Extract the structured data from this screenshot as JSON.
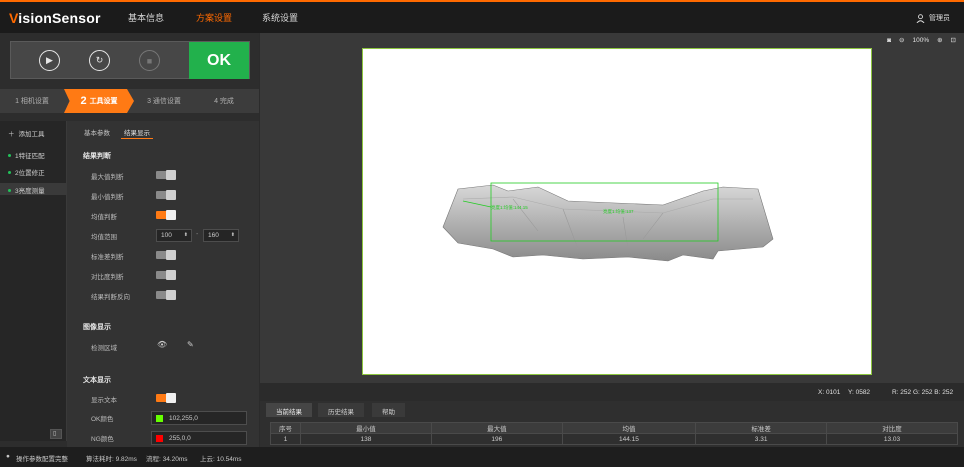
{
  "app": {
    "logo_prefix": "V",
    "logo_rest": "isionSensor"
  },
  "nav": {
    "items": [
      "基本信息",
      "方案设置",
      "系统设置"
    ],
    "active": 1
  },
  "user": {
    "name": "管理员"
  },
  "run": {
    "ok_label": "OK"
  },
  "steps": [
    {
      "num": "1",
      "label": "相机设置"
    },
    {
      "num": "2",
      "label": "工具设置"
    },
    {
      "num": "3",
      "label": "通信设置"
    },
    {
      "num": "4",
      "label": "完成"
    }
  ],
  "tree": {
    "add_tool": "添加工具",
    "items": [
      "1特征匹配",
      "2位置修正",
      "3亮度测量"
    ],
    "selected": 2
  },
  "panel": {
    "tabs": [
      "基本参数",
      "结果显示"
    ],
    "section_result": "结果判断",
    "rows": [
      "最大值判断",
      "最小值判断",
      "均值判断",
      "均值范围",
      "标准差判断",
      "对比度判断",
      "结果判断反向"
    ],
    "range_min": "100",
    "range_max": "160",
    "section_image": "图像显示",
    "detect_region": "检测区域",
    "section_text": "文本显示",
    "show_text": "显示文本",
    "ok_color_label": "OK颜色",
    "ok_color_value": "102,255,0",
    "ok_color": "#66ff00",
    "ng_color_label": "NG颜色",
    "ng_color_value": "255,0,0",
    "ng_color": "#ff0000"
  },
  "canvas": {
    "label1": "亮度1:均值:144.15",
    "label2": "亮度1:均值:137",
    "roi_color": "#22cc22"
  },
  "zoom": {
    "level": "100%"
  },
  "coords": {
    "x": "X: 0101",
    "y": "Y: 0582",
    "rgb": "R: 252  G: 252  B: 252"
  },
  "results": {
    "tabs": [
      "当前结果",
      "历史结果",
      "帮助"
    ],
    "headers": [
      "序号",
      "最小值",
      "最大值",
      "均值",
      "标准差",
      "对比度"
    ],
    "rows": [
      [
        "1",
        "138",
        "196",
        "144.15",
        "3.31",
        "13.03"
      ]
    ]
  },
  "status": {
    "mode": "操作参数配置完整",
    "algo": "算法耗时: 9.82ms",
    "flow": "流程: 34.20ms",
    "total": "上云: 10.54ms"
  }
}
